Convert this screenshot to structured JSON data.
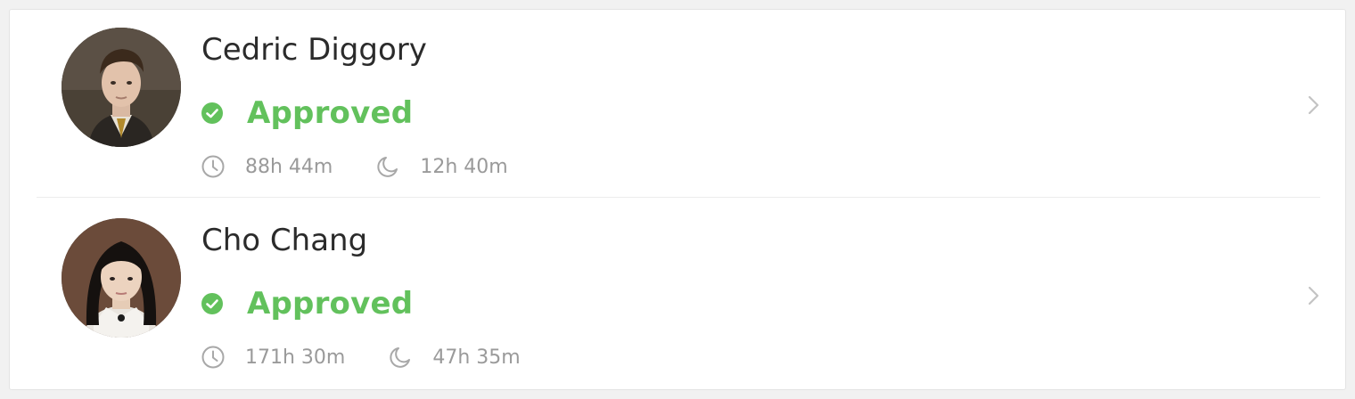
{
  "theme": {
    "accent_green": "#62c15c",
    "text_primary": "#2b2b2b",
    "text_muted": "#9a9a9a",
    "chevron": "#c3c3c3"
  },
  "people": [
    {
      "name": "Cedric Diggory",
      "status": "Approved",
      "status_icon": "check-circle-icon",
      "time_total": "88h 44m",
      "time_night": "12h 40m"
    },
    {
      "name": "Cho Chang",
      "status": "Approved",
      "status_icon": "check-circle-icon",
      "time_total": "171h 30m",
      "time_night": "47h 35m"
    }
  ],
  "icons": {
    "total_time": "clock-icon",
    "night_time": "moon-icon",
    "row_action": "chevron-right-icon"
  }
}
